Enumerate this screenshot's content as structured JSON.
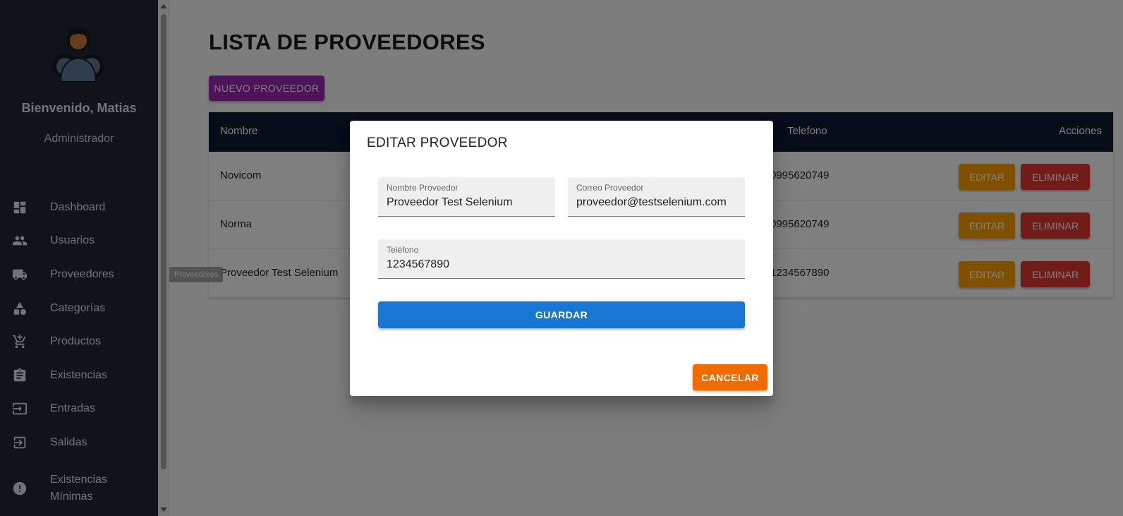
{
  "sidebar": {
    "welcome": "Bienvenido, Matias",
    "role": "Administrador",
    "items": [
      {
        "label": "Dashboard",
        "icon": "dashboard-icon"
      },
      {
        "label": "Usuarios",
        "icon": "users-icon"
      },
      {
        "label": "Proveedores",
        "icon": "truck-icon"
      },
      {
        "label": "Categorías",
        "icon": "category-icon"
      },
      {
        "label": "Productos",
        "icon": "cart-icon"
      },
      {
        "label": "Existencias",
        "icon": "clipboard-icon"
      },
      {
        "label": "Entradas",
        "icon": "login-icon"
      },
      {
        "label": "Salidas",
        "icon": "logout-icon"
      },
      {
        "label": "Existencias Mínimas",
        "icon": "alert-icon"
      }
    ]
  },
  "tooltip": "Proveedores",
  "main": {
    "title": "LISTA DE PROVEEDORES",
    "new_button": "NUEVO PROVEEDOR",
    "table": {
      "headers": {
        "name": "Nombre",
        "phone": "Telefono",
        "actions": "Acciones"
      },
      "rows": [
        {
          "name": "Novicom",
          "phone": "0995620749"
        },
        {
          "name": "Norma",
          "phone": "0995620749"
        },
        {
          "name": "Proveedor Test Selenium",
          "phone": "1234567890"
        }
      ],
      "edit_label": "EDITAR",
      "delete_label": "ELIMINAR"
    }
  },
  "dialog": {
    "title": "EDITAR PROVEEDOR",
    "fields": {
      "name": {
        "label": "Nombre Proveedor",
        "value": "Proveedor Test Selenium"
      },
      "email": {
        "label": "Correo Proveedor",
        "value": "proveedor@testselenium.com"
      },
      "phone": {
        "label": "Teléfono",
        "value": "1234567890"
      }
    },
    "save_label": "GUARDAR",
    "cancel_label": "CANCELAR"
  },
  "colors": {
    "sidebar_bg": "#1f2937",
    "table_header": "#0f1b30",
    "new_button": "#9c27b0",
    "edit_button": "#ffa000",
    "delete_button": "#e53935",
    "save_button": "#1976d2",
    "cancel_button": "#ef6c00"
  }
}
